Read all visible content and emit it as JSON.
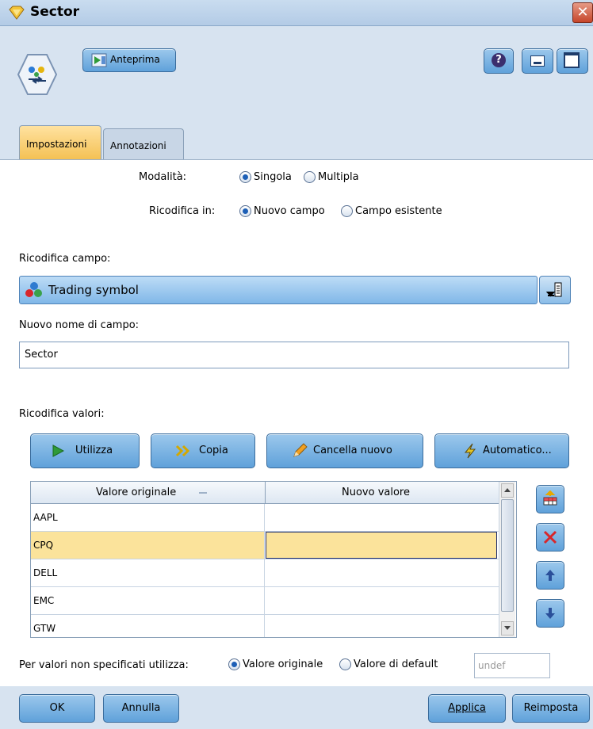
{
  "window": {
    "title": "Sector",
    "close_glyph": "✕"
  },
  "toolbar": {
    "preview_label": "Anteprima",
    "help_glyph": "?"
  },
  "tabs": [
    {
      "label": "Impostazioni",
      "active": true
    },
    {
      "label": "Annotazioni",
      "active": false
    }
  ],
  "settings": {
    "mode_label": "Modalità:",
    "mode_options": [
      {
        "label": "Singola",
        "selected": true
      },
      {
        "label": "Multipla",
        "selected": false
      }
    ],
    "recode_into_label": "Ricodifica in:",
    "recode_into_options": [
      {
        "label": "Nuovo campo",
        "selected": true
      },
      {
        "label": "Campo esistente",
        "selected": false
      }
    ],
    "recode_field_label": "Ricodifica campo:",
    "recode_field_value": "Trading symbol",
    "new_field_name_label": "Nuovo nome di campo:",
    "new_field_name_value": "Sector",
    "recode_values_label": "Ricodifica valori:"
  },
  "actions": {
    "use": "Utilizza",
    "copy": "Copia",
    "clear_new": "Cancella nuovo",
    "auto": "Automatico..."
  },
  "table": {
    "columns": [
      "Valore originale",
      "Nuovo valore"
    ],
    "rows": [
      {
        "original": "AAPL",
        "new": "",
        "selected": false
      },
      {
        "original": "CPQ",
        "new": "",
        "selected": true
      },
      {
        "original": "DELL",
        "new": "",
        "selected": false
      },
      {
        "original": "EMC",
        "new": "",
        "selected": false
      },
      {
        "original": "GTW",
        "new": "",
        "selected": false
      }
    ]
  },
  "unspecified": {
    "label": "Per valori non specificati utilizza:",
    "options": [
      {
        "label": "Valore originale",
        "selected": true
      },
      {
        "label": "Valore di default",
        "selected": false
      }
    ],
    "default_value": "undef"
  },
  "footer": {
    "ok": "OK",
    "cancel": "Annulla",
    "apply": "Applica",
    "reset": "Reimposta"
  },
  "colors": {
    "accent_tab": "#f4c154",
    "selection": "#fbe39b",
    "button_blue": "#5fa1da",
    "delete_red": "#d8262b"
  }
}
